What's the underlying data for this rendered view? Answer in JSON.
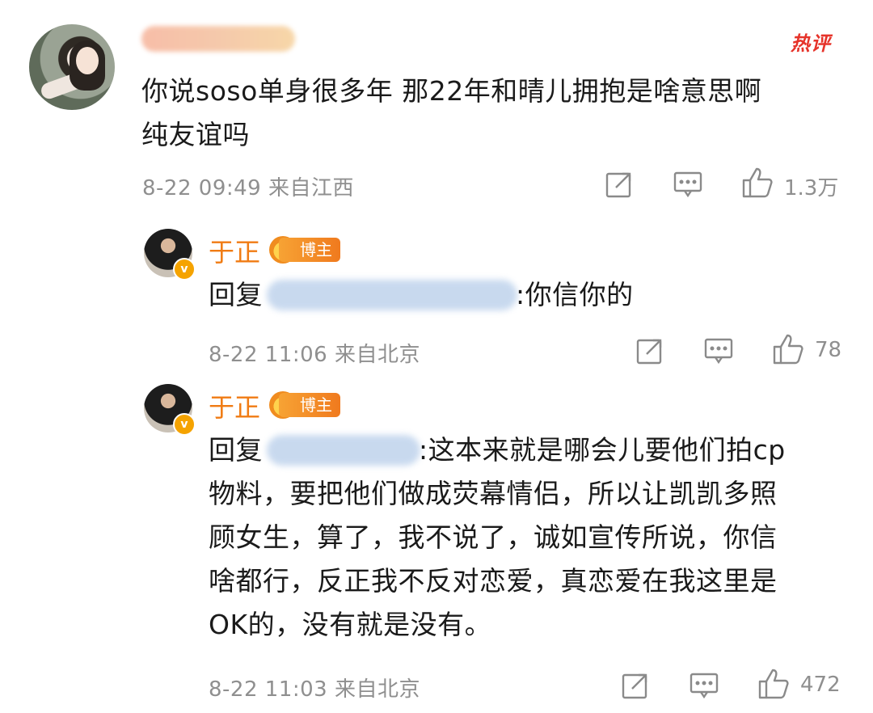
{
  "top_comment": {
    "badge": "热评",
    "text_lines": [
      "你说soso单身很多年 那22年和晴儿拥抱是啥意思啊",
      "纯友谊吗"
    ],
    "meta": "8-22 09:49 来自江西",
    "likes": "1.3万"
  },
  "replies": [
    {
      "author": "于正",
      "badge": "博主",
      "reply_prefix": "回复",
      "text_lines": [
        ":你信你的"
      ],
      "meta": "8-22 11:06 来自北京",
      "likes": "78"
    },
    {
      "author": "于正",
      "badge": "博主",
      "reply_prefix": "回复",
      "text_lines": [
        ":这本来就是哪会儿要他们拍cp",
        "物料，要把他们做成荧幕情侣，所以让凯凯多照",
        "顾女生，算了，我不说了，诚如宣传所说，你信",
        "啥都行，反正我不反对恋爱，真恋爱在我这里是",
        "OK的，没有就是没有。"
      ],
      "meta": "8-22 11:03 来自北京",
      "likes": "472"
    }
  ],
  "icons": [
    "share-icon",
    "comment-icon",
    "like-icon",
    "verified-icon",
    "crown-icon"
  ],
  "colors": {
    "author": "#f07b13",
    "hot_badge": "#e6332a",
    "meta": "#8f8f8f"
  }
}
